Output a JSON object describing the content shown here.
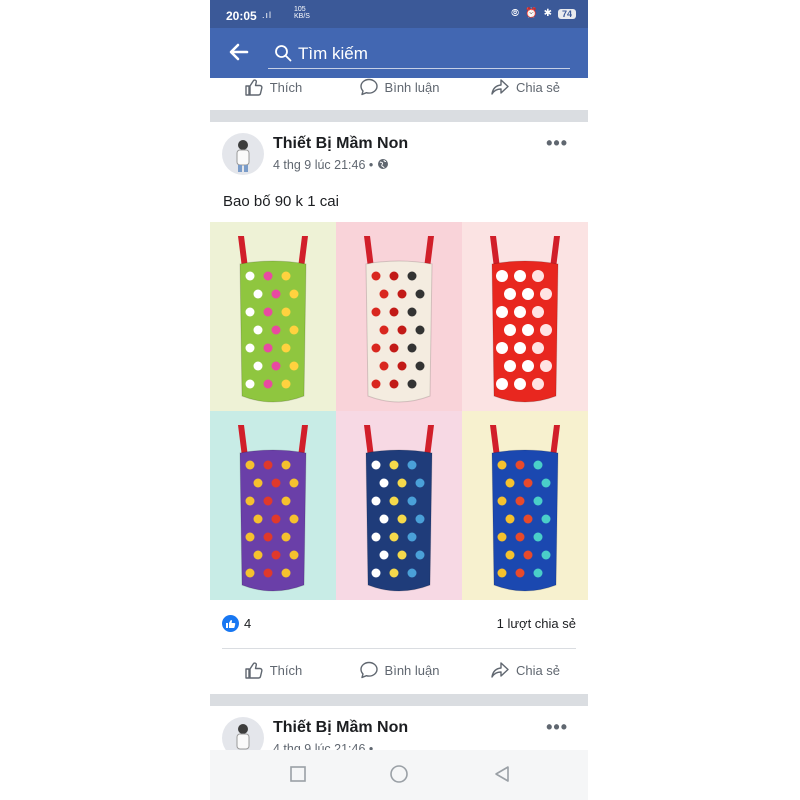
{
  "status_bar": {
    "time": "20:05",
    "signal": ".ıl",
    "speed_value": "105",
    "speed_unit": "KB/S",
    "battery": "74"
  },
  "search": {
    "placeholder": "Tìm kiếm"
  },
  "actions": {
    "like": "Thích",
    "comment": "Bình luận",
    "share": "Chia sẻ"
  },
  "post": {
    "author": "Thiết Bị Mầm Non",
    "timestamp": "4 thg 9 lúc 21:46 •",
    "text": "Bao bố 90 k 1 cai",
    "like_count": "4",
    "share_count": "1 lượt chia sẻ",
    "images": [
      {
        "bg": "#eef2d6",
        "bag": "#8fc63f",
        "pattern": "butterflies"
      },
      {
        "bg": "#f9d3d9",
        "bag": "#f4ece0",
        "pattern": "ladybugs"
      },
      {
        "bg": "#fbe3e3",
        "bag": "#e8271f",
        "pattern": "paws"
      },
      {
        "bg": "#c8ece6",
        "bag": "#6a3fa8",
        "pattern": "pooh"
      },
      {
        "bg": "#f7d9e4",
        "bag": "#1f3c7a",
        "pattern": "snoopy"
      },
      {
        "bg": "#f7f1cf",
        "bag": "#1b48b0",
        "pattern": "fish"
      }
    ]
  },
  "next_post": {
    "author": "Thiết Bị Mầm Non",
    "timestamp": "4 thg 9 lúc 21:46 •"
  }
}
